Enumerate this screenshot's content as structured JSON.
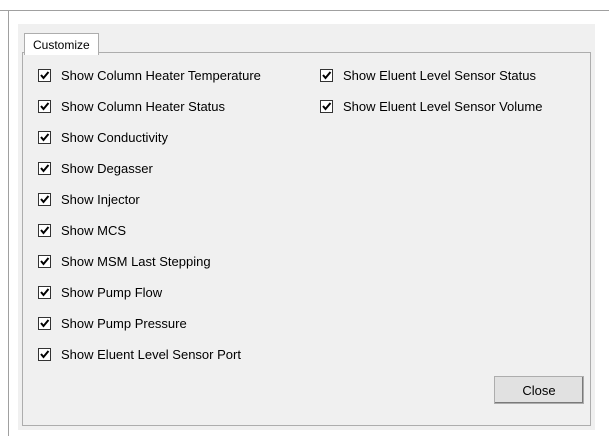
{
  "tab": {
    "label": "Customize"
  },
  "options": [
    {
      "label": "Show Column Heater Temperature",
      "checked": true
    },
    {
      "label": "Show Column Heater Status",
      "checked": true
    },
    {
      "label": "Show Conductivity",
      "checked": true
    },
    {
      "label": "Show Degasser",
      "checked": true
    },
    {
      "label": "Show Injector",
      "checked": true
    },
    {
      "label": "Show MCS",
      "checked": true
    },
    {
      "label": "Show MSM Last Stepping",
      "checked": true
    },
    {
      "label": "Show Pump Flow",
      "checked": true
    },
    {
      "label": "Show Pump Pressure",
      "checked": true
    },
    {
      "label": "Show Eluent Level Sensor Port",
      "checked": true
    },
    {
      "label": "Show Eluent Level Sensor Status",
      "checked": true
    },
    {
      "label": "Show Eluent Level Sensor Volume",
      "checked": true
    }
  ],
  "buttons": {
    "close_label": "Close"
  }
}
